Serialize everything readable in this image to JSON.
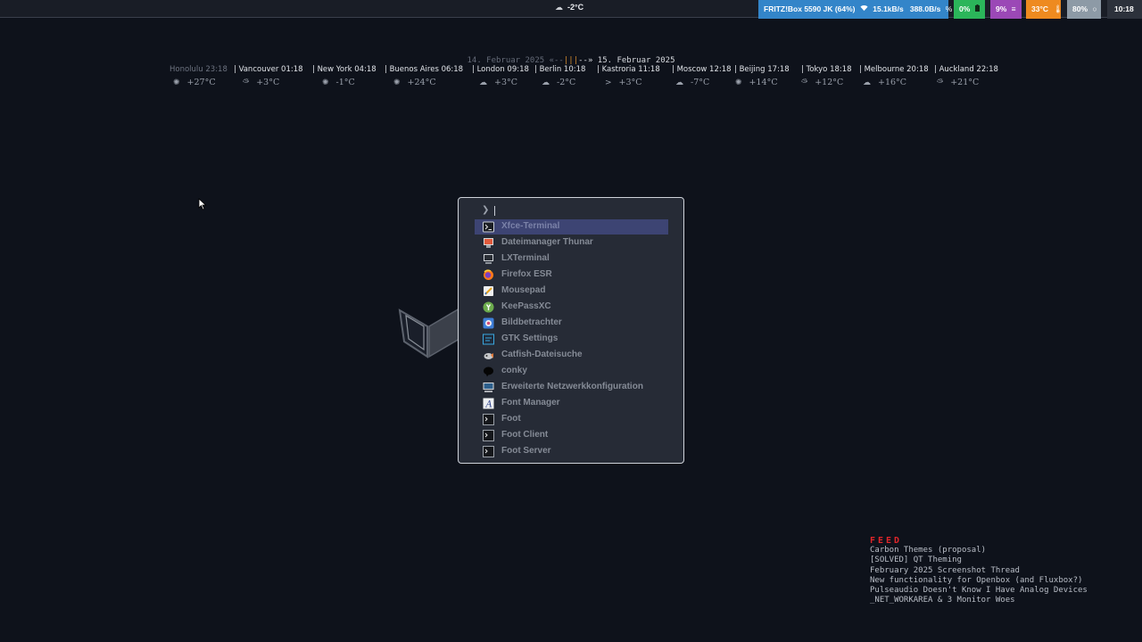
{
  "topbar": {
    "weather": {
      "icon": "cloud-icon",
      "temp": "-2°C"
    },
    "network": {
      "ssid": "FRITZ!Box 5590 JK (64%)",
      "down": "15.1kB/s",
      "up": "388.0B/s",
      "color": "#3385c9"
    },
    "battery": {
      "value": "0%",
      "color": "#2bb55a"
    },
    "cpu": {
      "value": "9%",
      "color": "#9b48b6"
    },
    "temperature": {
      "value": "33°C",
      "color": "#ee8a20"
    },
    "brightness": {
      "value": "80%",
      "color": "#8d9aa6"
    },
    "clock": "10:18"
  },
  "worldclock": {
    "date_prev": "14. Februar 2025 «--",
    "marker": "|||",
    "date_next": "--» 15. Februar 2025",
    "cities": [
      {
        "label": "Honolulu 23:18",
        "temp": "+27°C",
        "icon": "sun-icon"
      },
      {
        "label": "| Vancouver 01:18",
        "temp": "+3°C",
        "icon": "partly-cloudy-icon"
      },
      {
        "label": "| New York 04:18",
        "temp": "-1°C",
        "icon": "sun-icon"
      },
      {
        "label": "| Buenos Aires 06:18",
        "temp": "+24°C",
        "icon": "sun-icon"
      },
      {
        "label": "| London 09:18",
        "temp": "+3°C",
        "icon": "cloud-icon"
      },
      {
        "label": "| Berlin 10:18",
        "temp": "-2°C",
        "icon": "cloud-icon"
      },
      {
        "label": "| Kastroria 11:18",
        "temp": "+3°C",
        "icon": "wind-icon"
      },
      {
        "label": "| Moscow 12:18",
        "temp": "-7°C",
        "icon": "cloud-icon"
      },
      {
        "label": "| Beijing 17:18",
        "temp": "+14°C",
        "icon": "sun-icon"
      },
      {
        "label": "| Tokyo 18:18",
        "temp": "+12°C",
        "icon": "partly-cloudy-icon"
      },
      {
        "label": "| Melbourne 20:18",
        "temp": "+16°C",
        "icon": "cloud-icon"
      },
      {
        "label": "| Auckland 22:18",
        "temp": "+21°C",
        "icon": "partly-cloudy-icon"
      }
    ]
  },
  "launcher": {
    "prompt": "❯",
    "query": "",
    "items": [
      {
        "label": "Xfce-Terminal",
        "icon": "terminal-icon"
      },
      {
        "label": "Dateimanager Thunar",
        "icon": "file-manager-icon"
      },
      {
        "label": "LXTerminal",
        "icon": "monitor-icon"
      },
      {
        "label": "Firefox ESR",
        "icon": "firefox-icon"
      },
      {
        "label": "Mousepad",
        "icon": "text-editor-icon"
      },
      {
        "label": "KeePassXC",
        "icon": "keepass-icon"
      },
      {
        "label": "Bildbetrachter",
        "icon": "image-viewer-icon"
      },
      {
        "label": "GTK Settings",
        "icon": "settings-icon"
      },
      {
        "label": "Catfish-Dateisuche",
        "icon": "catfish-icon"
      },
      {
        "label": "conky",
        "icon": "conky-icon"
      },
      {
        "label": "Erweiterte Netzwerkkonfiguration",
        "icon": "network-icon"
      },
      {
        "label": "Font Manager",
        "icon": "font-icon"
      },
      {
        "label": "Foot",
        "icon": "terminal-icon"
      },
      {
        "label": "Foot Client",
        "icon": "terminal-icon"
      },
      {
        "label": "Foot Server",
        "icon": "terminal-icon"
      }
    ],
    "selected_index": 0
  },
  "feed": {
    "title": "FEED",
    "items": [
      "Carbon Themes (proposal)",
      "[SOLVED] QT Theming",
      "February 2025 Screenshot Thread",
      "New functionality for Openbox (and Fluxbox?)",
      "Pulseaudio Doesn't Know I Have Analog Devices",
      "_NET_WORKAREA & 3 Monitor Woes"
    ]
  }
}
